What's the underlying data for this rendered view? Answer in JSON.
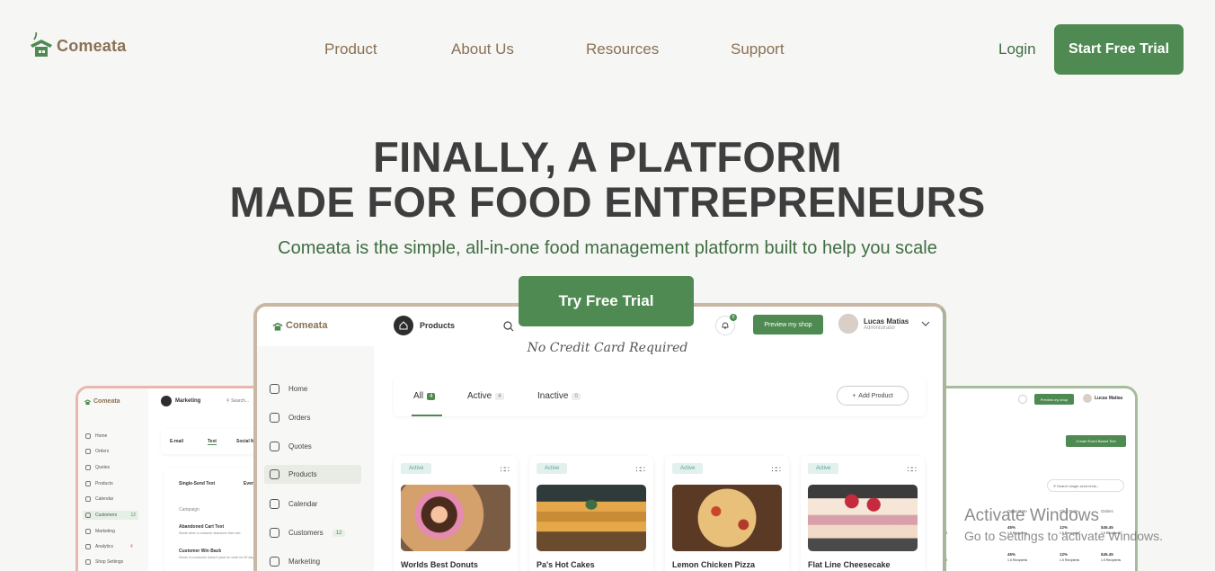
{
  "nav": {
    "logo_text": "Comeata",
    "links": [
      "Product",
      "About Us",
      "Resources",
      "Support"
    ],
    "login": "Login",
    "cta": "Start Free Trial"
  },
  "hero": {
    "title_line1": "FINALLY, A PLATFORM",
    "title_line2": "MADE FOR FOOD ENTREPRENEURS",
    "subtitle": "Comeata is the simple, all-in-one food management platform built to help you scale",
    "cta": "Try Free Trial",
    "note": "No Credit Card Required"
  },
  "mockup_main": {
    "logo_text": "Comeata",
    "breadcrumb": "Products",
    "notification_count": "0",
    "preview_button": "Preview my shop",
    "user_name": "Lucas Matias",
    "user_role": "Administrator",
    "sidebar": [
      {
        "label": "Home"
      },
      {
        "label": "Orders"
      },
      {
        "label": "Quotes"
      },
      {
        "label": "Products"
      },
      {
        "label": "Calendar"
      },
      {
        "label": "Customers",
        "count": "12"
      },
      {
        "label": "Marketing"
      }
    ],
    "tabs": [
      {
        "label": "All",
        "count": "4"
      },
      {
        "label": "Active",
        "count": "4"
      },
      {
        "label": "Inactive",
        "count": "0"
      }
    ],
    "add_product": "Add Product",
    "products": [
      {
        "status": "Active",
        "name": "Worlds Best Donuts"
      },
      {
        "status": "Active",
        "name": "Pa's Hot Cakes"
      },
      {
        "status": "Active",
        "name": "Lemon Chicken Pizza"
      },
      {
        "status": "Active",
        "name": "Flat Line Cheesecake"
      }
    ]
  },
  "mockup_left": {
    "logo_text": "Comeata",
    "breadcrumb": "Marketing",
    "search": "Search...",
    "sidebar": [
      {
        "label": "Home"
      },
      {
        "label": "Orders"
      },
      {
        "label": "Quotes"
      },
      {
        "label": "Products"
      },
      {
        "label": "Calendar"
      },
      {
        "label": "Customers",
        "count": "12"
      },
      {
        "label": "Marketing"
      },
      {
        "label": "Analytics",
        "count": "4"
      },
      {
        "label": "Shop Settings"
      }
    ],
    "tabs": [
      "E-mail",
      "Text",
      "Social Me"
    ],
    "subtabs": [
      "Single-Send Text",
      "Even"
    ],
    "table_header": "Campaign",
    "rows": [
      {
        "title": "Abandoned Cart Text",
        "desc": "Sends when a customer abandons their cart"
      },
      {
        "title": "Customer Win Back",
        "desc": "Sends if a customer doesn't place an order for 60 days"
      }
    ]
  },
  "mockup_right": {
    "preview_button": "Preview my shop",
    "user_name": "Lucas Matias",
    "user_role": "Administrator",
    "section_label": "ing",
    "create_button": "Create Event Based Text",
    "table_label": "de",
    "search": "Search single-send texts...",
    "columns": [
      "Open Rate",
      "Click Rate",
      "Orders"
    ],
    "rows": [
      {
        "date": "ta am",
        "open": "45%",
        "open_sub": "1.5 Recipients",
        "click": "12%",
        "click_sub": "1.5 Recipients",
        "orders": "$45.45",
        "orders_sub": "1.5 Recipients"
      },
      {
        "date": "ta am",
        "open": "45%",
        "open_sub": "1.5 Recipients",
        "click": "12%",
        "click_sub": "1.5 Recipients",
        "orders": "$45.45",
        "orders_sub": "1.5 Recipients"
      }
    ]
  },
  "watermark": {
    "line1": "Activate Windows",
    "line2": "Go to Settings to activate Windows."
  },
  "colors": {
    "brand_green": "#4f8a52",
    "brand_brown": "#8a7153",
    "heading": "#3e3e3e",
    "background": "#f6f6f5"
  }
}
